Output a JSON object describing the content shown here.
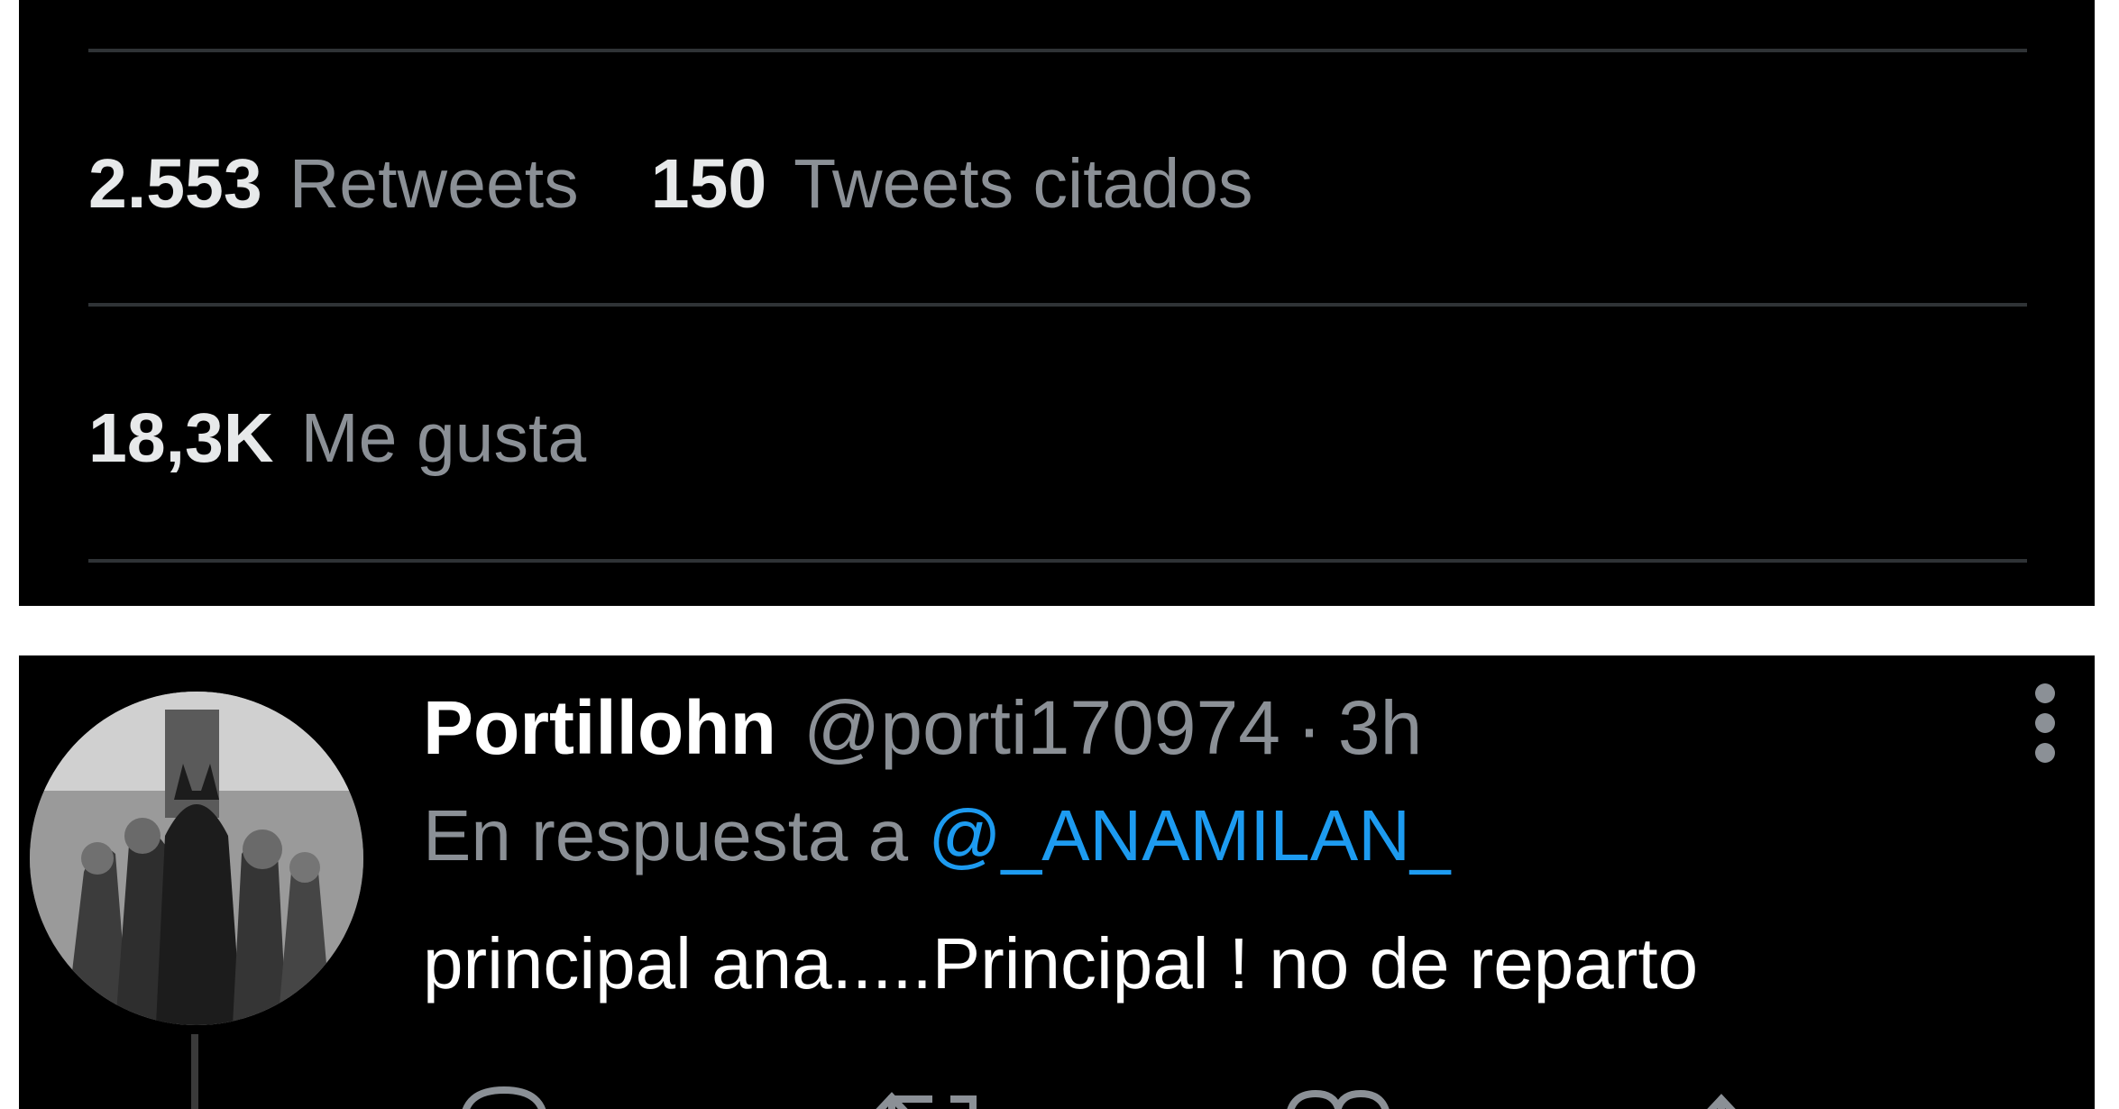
{
  "stats": {
    "retweets": {
      "count": "2.553",
      "label": "Retweets"
    },
    "quotes": {
      "count": "150",
      "label": "Tweets citados"
    },
    "likes": {
      "count": "18,3K",
      "label": "Me gusta"
    }
  },
  "reply": {
    "author_name": "Portillohn",
    "author_handle": "@porti170974",
    "separator": "·",
    "time": "3h",
    "reply_prefix": "En respuesta a",
    "reply_to_handle": "@_ANAMILAN_",
    "text": "principal ana.....Principal ! no de reparto",
    "avatar_icon": "avatar-photo",
    "more_icon": "more-vertical-icon"
  },
  "colors": {
    "background": "#000000",
    "text_primary": "#e7e9ea",
    "text_secondary": "#8b9096",
    "link": "#1d9bf0",
    "divider": "#2f3336"
  }
}
